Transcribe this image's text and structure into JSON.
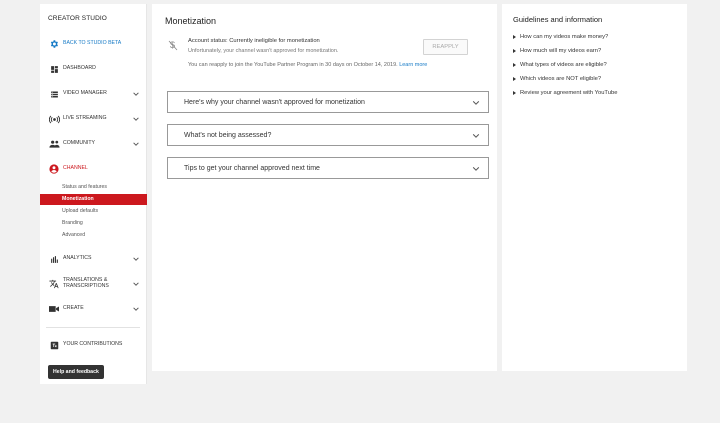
{
  "sidebar": {
    "title": "CREATOR STUDIO",
    "back": "BACK TO STUDIO BETA",
    "items": [
      {
        "label": "DASHBOARD"
      },
      {
        "label": "VIDEO MANAGER"
      },
      {
        "label": "LIVE STREAMING"
      },
      {
        "label": "COMMUNITY"
      },
      {
        "label": "CHANNEL"
      },
      {
        "label": "ANALYTICS"
      },
      {
        "label": "TRANSLATIONS & TRANSCRIPTIONS"
      },
      {
        "label": "CREATE"
      },
      {
        "label": "YOUR CONTRIBUTIONS"
      }
    ],
    "channel_sub": [
      "Status and features",
      "Monetization",
      "Upload defaults",
      "Branding",
      "Advanced"
    ],
    "help": "Help and feedback",
    "colors": {
      "active": "#cc181e",
      "link": "#167ac6"
    }
  },
  "main": {
    "title": "Monetization",
    "status": "Account status: Currently ineligible for monetization",
    "status_detail": "Unfortunately, your channel wasn't approved for monetization.",
    "reapply_note": "You can reapply to join the YouTube Partner Program in 30 days on October 14, 2019.",
    "learn_more": "Learn more",
    "reapply_button": "REAPPLY",
    "accordions": [
      {
        "label": "Here's why your channel wasn't approved for monetization"
      },
      {
        "label": "What's not being assessed?"
      },
      {
        "label": "Tips to get your channel approved next time"
      }
    ]
  },
  "guidelines": {
    "title": "Guidelines and information",
    "links": [
      "How can my videos make money?",
      "How much will my videos earn?",
      "What types of videos are eligible?",
      "Which videos are NOT eligible?",
      "Review your agreement with YouTube"
    ]
  }
}
